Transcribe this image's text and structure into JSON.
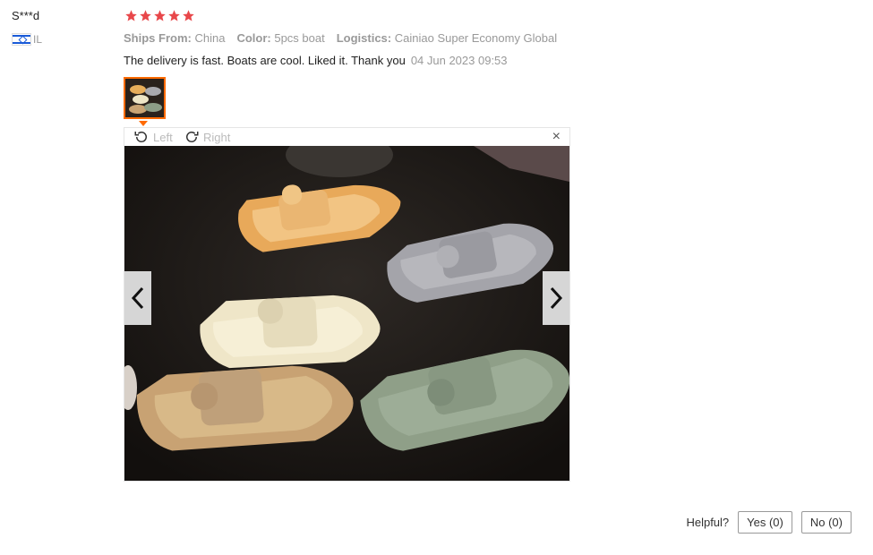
{
  "reviewer": {
    "name": "S***d",
    "country": "IL",
    "flag": "israel-flag"
  },
  "rating": {
    "stars": 5,
    "max": 5,
    "color": "#e8474a"
  },
  "meta": [
    {
      "key": "Ships From:",
      "value": "China"
    },
    {
      "key": "Color:",
      "value": "5pcs boat"
    },
    {
      "key": "Logistics:",
      "value": "Cainiao Super Economy Global"
    }
  ],
  "review": {
    "text": "The delivery is fast. Boats are cool. Liked it. Thank you",
    "date": "04 Jun 2023 09:53"
  },
  "viewer": {
    "rotate_left": "Left",
    "rotate_right": "Right",
    "close": "×"
  },
  "helpful": {
    "label": "Helpful?",
    "yes": "Yes (0)",
    "no": "No (0)"
  },
  "colors": {
    "accent": "#ff6a00",
    "muted": "#999999"
  }
}
